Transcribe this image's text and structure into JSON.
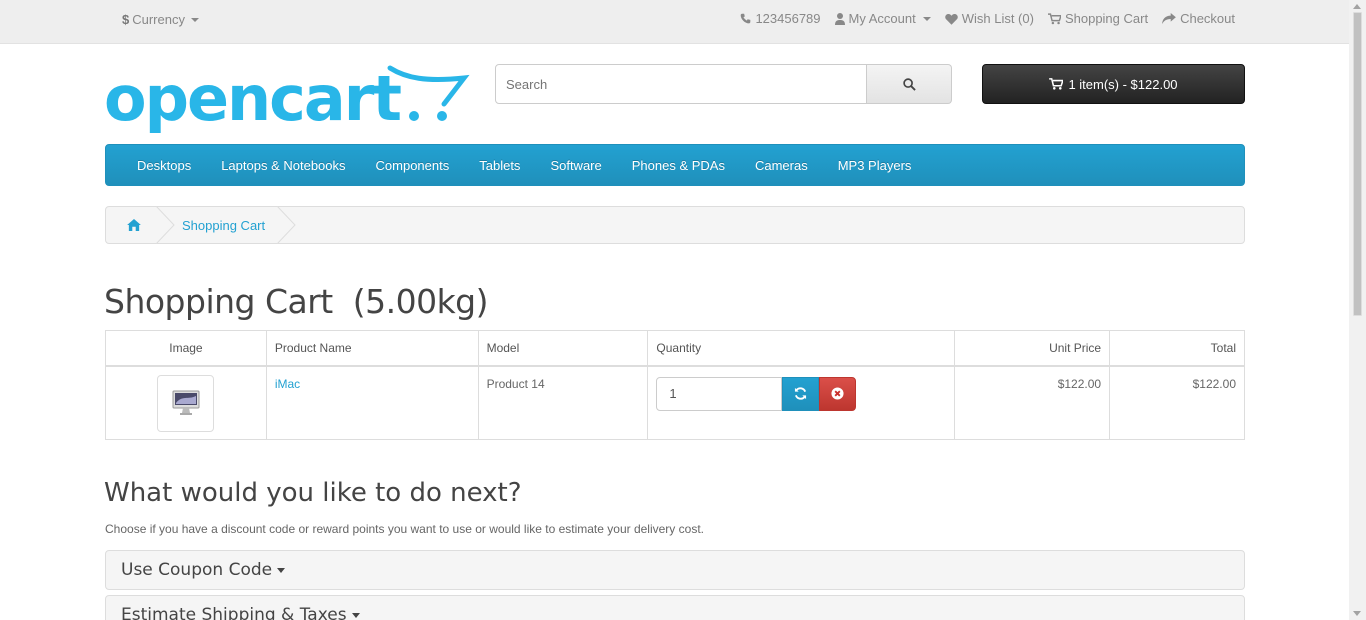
{
  "topbar": {
    "currency_symbol": "$",
    "currency_label": "Currency",
    "phone": "123456789",
    "my_account": "My Account",
    "wish_list": "Wish List (0)",
    "shopping_cart": "Shopping Cart",
    "checkout": "Checkout"
  },
  "logo": {
    "text": "opencart"
  },
  "search": {
    "placeholder": "Search"
  },
  "cart_button": {
    "label": "1 item(s) - $122.00"
  },
  "menu": {
    "items": [
      "Desktops",
      "Laptops & Notebooks",
      "Components",
      "Tablets",
      "Software",
      "Phones & PDAs",
      "Cameras",
      "MP3 Players"
    ]
  },
  "breadcrumb": {
    "current": "Shopping Cart"
  },
  "page": {
    "title": "Shopping Cart  (5.00kg)"
  },
  "cart_table": {
    "headers": {
      "image": "Image",
      "name": "Product Name",
      "model": "Model",
      "quantity": "Quantity",
      "unit_price": "Unit Price",
      "total": "Total"
    },
    "rows": [
      {
        "name": "iMac",
        "model": "Product 14",
        "quantity": "1",
        "unit_price": "$122.00",
        "total": "$122.00"
      }
    ]
  },
  "next": {
    "heading": "What would you like to do next?",
    "hint": "Choose if you have a discount code or reward points you want to use or would like to estimate your delivery cost.",
    "panels": [
      "Use Coupon Code",
      "Estimate Shipping & Taxes"
    ]
  },
  "colors": {
    "accent": "#23a1d1",
    "logo": "#29b6e8",
    "danger": "#da4f49",
    "cart_button": "#2d2d2d"
  }
}
